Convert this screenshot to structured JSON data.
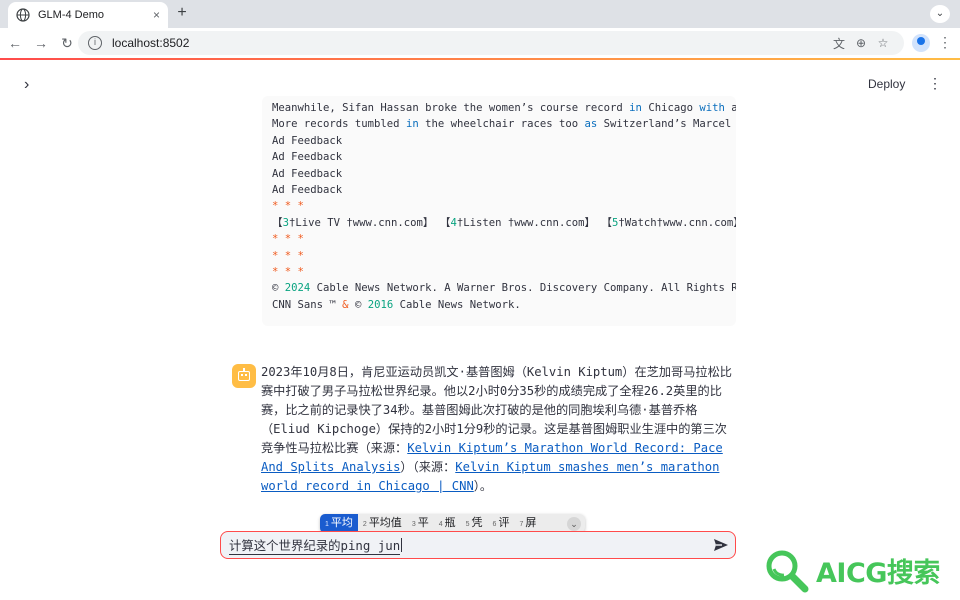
{
  "browser": {
    "tab_title": "GLM-4 Demo",
    "tab_close": "×",
    "new_tab": "+",
    "url": "localhost:8502"
  },
  "app": {
    "sidebar_toggle": "›",
    "deploy_label": "Deploy",
    "menu_glyph": "⋮"
  },
  "code_block": {
    "lines": [
      [
        {
          "t": "Meanwhile, Sifan Hassan broke the women’s course record "
        },
        {
          "t": "in",
          "c": "kw"
        },
        {
          "t": " Chicago "
        },
        {
          "t": "with",
          "c": "kw"
        },
        {
          "t": " a t"
        }
      ],
      [
        {
          "t": "More records tumbled "
        },
        {
          "t": "in",
          "c": "kw"
        },
        {
          "t": " the wheelchair races too "
        },
        {
          "t": "as",
          "c": "kw"
        },
        {
          "t": " Switzerland’s Marcel Hu"
        }
      ],
      [
        {
          "t": "Ad Feedback"
        }
      ],
      [
        {
          "t": "Ad Feedback"
        }
      ],
      [
        {
          "t": "Ad Feedback"
        }
      ],
      [
        {
          "t": "Ad Feedback"
        }
      ],
      [
        {
          "t": "* * *",
          "c": "star"
        }
      ],
      [
        {
          "t": "【"
        },
        {
          "t": "3",
          "c": "num"
        },
        {
          "t": "†Live TV †www.cnn.com】 【"
        },
        {
          "t": "4",
          "c": "num"
        },
        {
          "t": "†Listen †www.cnn.com】 【"
        },
        {
          "t": "5",
          "c": "num"
        },
        {
          "t": "†Watch†www.cnn.com】"
        }
      ],
      [
        {
          "t": "* * *",
          "c": "star"
        }
      ],
      [
        {
          "t": "* * *",
          "c": "star"
        }
      ],
      [
        {
          "t": "* * *",
          "c": "star"
        }
      ],
      [
        {
          "t": "© "
        },
        {
          "t": "2024",
          "c": "num"
        },
        {
          "t": " Cable News Network. A Warner Bros. Discovery Company. All Rights Rese"
        }
      ],
      [
        {
          "t": "CNN Sans ™ "
        },
        {
          "t": "&",
          "c": "star"
        },
        {
          "t": " © "
        },
        {
          "t": "2016",
          "c": "num"
        },
        {
          "t": " Cable News Network."
        }
      ]
    ]
  },
  "assistant": {
    "text_before_link1": "2023年10月8日，肯尼亚运动员凯文·基普图姆（Kelvin Kiptum）在芝加哥马拉松比赛中打破了男子马拉松世界纪录。他以2小时0分35秒的成绩完成了全程26.2英里的比赛，比之前的记录快了34秒。基普图姆此次打破的是他的同胞埃利乌德·基普乔格（Eliud Kipchoge）保持的2小时1分9秒的记录。这是基普图姆职业生涯中的第三次竞争性马拉松比赛（来源：",
    "link1": "Kelvin Kiptum’s Marathon World Record: Pace And Splits Analysis",
    "text_between": "）（来源：",
    "link2": "Kelvin Kiptum smashes men’s marathon world record in Chicago | CNN",
    "text_after": "）。"
  },
  "ime": {
    "candidates": [
      {
        "n": "1",
        "label": "平均"
      },
      {
        "n": "2",
        "label": "平均值"
      },
      {
        "n": "3",
        "label": "平"
      },
      {
        "n": "4",
        "label": "瓶"
      },
      {
        "n": "5",
        "label": "凭"
      },
      {
        "n": "6",
        "label": "评"
      },
      {
        "n": "7",
        "label": "屏"
      }
    ],
    "more_glyph": "⌄"
  },
  "chat_input": {
    "value": "计算这个世界纪录的ping jun"
  },
  "watermark": {
    "text": "AICG搜索"
  },
  "colors": {
    "accent": "#ff4b4b",
    "link": "#0a5cc2",
    "avatar": "#ffbd45",
    "watermark": "#46c65a"
  }
}
